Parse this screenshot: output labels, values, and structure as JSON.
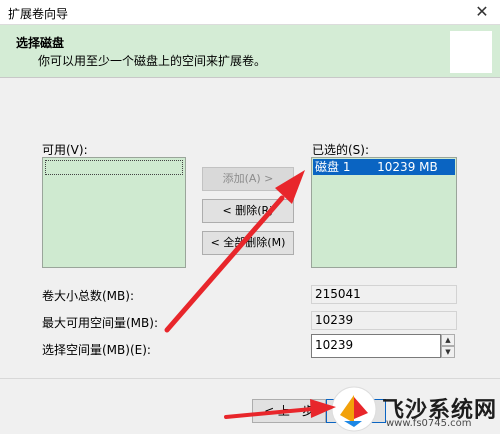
{
  "window": {
    "title": "扩展卷向导"
  },
  "header": {
    "title": "选择磁盘",
    "description": "你可以用至少一个磁盘上的空间来扩展卷。"
  },
  "available": {
    "label": "可用(V):",
    "items": []
  },
  "selected": {
    "label": "已选的(S):",
    "items": [
      "磁盘 1       10239 MB"
    ]
  },
  "buttons": {
    "add": "添加(A) >",
    "remove": "< 删除(R)",
    "remove_all": "< 全部删除(M)"
  },
  "fields": {
    "total_label": "卷大小总数(MB):",
    "total_value": "215041",
    "max_label": "最大可用空间量(MB):",
    "max_value": "10239",
    "select_label": "选择空间量(MB)(E):",
    "select_value": "10239"
  },
  "nav": {
    "back": "< 上一步",
    "next": ""
  },
  "watermark": {
    "text": "飞沙系统网",
    "url": "www.fs0745.com"
  },
  "colors": {
    "header_bg": "#d4ecd5",
    "list_bg": "#cfead0",
    "selection": "#0a64c2",
    "arrow": "#e8262b"
  }
}
